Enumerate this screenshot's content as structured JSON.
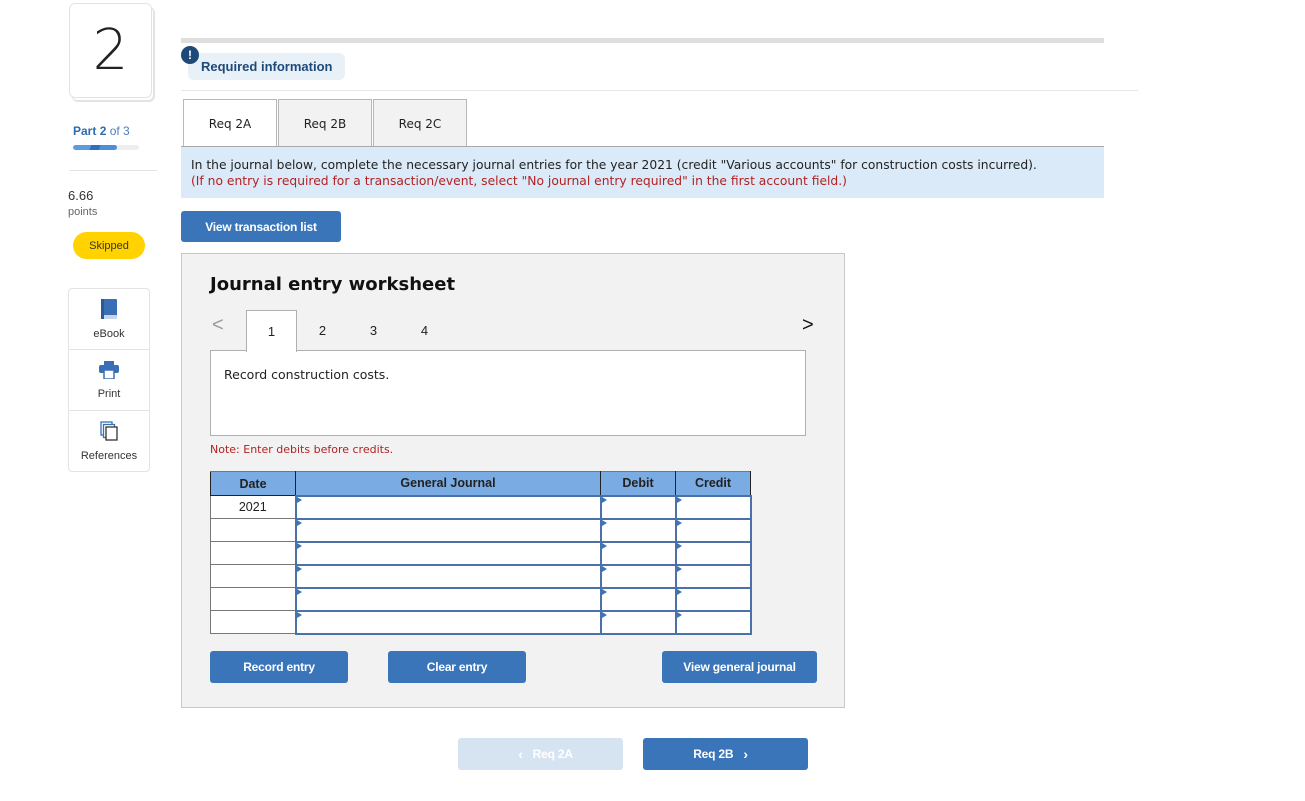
{
  "sidebar": {
    "question_number": "2",
    "part_prefix": "Part",
    "part_current": "2",
    "part_of": "of 3",
    "progress_fraction": 0.67,
    "points_value": "6.66",
    "points_label": "points",
    "status_badge": "Skipped",
    "tools": [
      {
        "label": "eBook",
        "icon": "book-icon"
      },
      {
        "label": "Print",
        "icon": "printer-icon"
      },
      {
        "label": "References",
        "icon": "references-icon"
      }
    ]
  },
  "header": {
    "alert_glyph": "!",
    "required_info_label": "Required information"
  },
  "req_tabs": [
    {
      "label": "Req 2A",
      "active": true
    },
    {
      "label": "Req 2B",
      "active": false
    },
    {
      "label": "Req 2C",
      "active": false
    }
  ],
  "instructions": {
    "line1": "In the journal below, complete the necessary journal entries for the year 2021 (credit \"Various accounts\" for construction costs incurred).",
    "line2": "(If no entry is required for a transaction/event, select \"No journal entry required\" in the first account field.)"
  },
  "view_transaction_list_label": "View transaction list",
  "worksheet": {
    "title": "Journal entry worksheet",
    "prev_glyph": "<",
    "next_glyph": ">",
    "pages": [
      "1",
      "2",
      "3",
      "4"
    ],
    "active_page": "1",
    "description": "Record construction costs.",
    "note": "Note: Enter debits before credits.",
    "table": {
      "headers": {
        "date": "Date",
        "general_journal": "General Journal",
        "debit": "Debit",
        "credit": "Credit"
      },
      "rows": [
        {
          "date": "2021",
          "account": "",
          "debit": "",
          "credit": ""
        },
        {
          "date": "",
          "account": "",
          "debit": "",
          "credit": ""
        },
        {
          "date": "",
          "account": "",
          "debit": "",
          "credit": ""
        },
        {
          "date": "",
          "account": "",
          "debit": "",
          "credit": ""
        },
        {
          "date": "",
          "account": "",
          "debit": "",
          "credit": ""
        },
        {
          "date": "",
          "account": "",
          "debit": "",
          "credit": ""
        }
      ]
    },
    "record_entry_label": "Record entry",
    "clear_entry_label": "Clear entry",
    "view_general_journal_label": "View general journal"
  },
  "bottom_nav": {
    "prev_label": "Req 2A",
    "next_label": "Req 2B",
    "prev_glyph": "‹",
    "next_glyph": "›"
  }
}
